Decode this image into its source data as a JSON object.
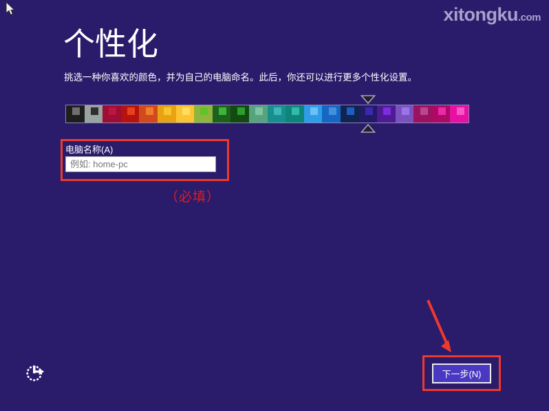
{
  "page": {
    "title": "个性化",
    "subtitle": "挑选一种你喜欢的颜色，并为自己的电脑命名。此后，你还可以进行更多个性化设置。"
  },
  "logo": {
    "name": "xitongku",
    "tld": ".com"
  },
  "color_picker": {
    "selected_index": 16,
    "swatches": [
      {
        "bg": "#1e1e1e",
        "accent": "#6f6f6f"
      },
      {
        "bg": "#9aa2a2",
        "accent": "#2e2e2e"
      },
      {
        "bg": "#9e0d33",
        "accent": "#c11342"
      },
      {
        "bg": "#b51210",
        "accent": "#e5421d"
      },
      {
        "bg": "#d2491c",
        "accent": "#ef7d2e"
      },
      {
        "bg": "#e8a312",
        "accent": "#fbc232"
      },
      {
        "bg": "#fdc431",
        "accent": "#ffdc64"
      },
      {
        "bg": "#8fb63c",
        "accent": "#62c22b"
      },
      {
        "bg": "#1d611d",
        "accent": "#3bb53b"
      },
      {
        "bg": "#124a12",
        "accent": "#2b9e2b"
      },
      {
        "bg": "#56a47d",
        "accent": "#81c4a4"
      },
      {
        "bg": "#178f8f",
        "accent": "#3cb8b8"
      },
      {
        "bg": "#0f8579",
        "accent": "#2fbcab"
      },
      {
        "bg": "#2e9de8",
        "accent": "#70c0f5"
      },
      {
        "bg": "#1667c4",
        "accent": "#4590dc"
      },
      {
        "bg": "#12234f",
        "accent": "#1d5fc4"
      },
      {
        "bg": "#231a66",
        "accent": "#3a29ad"
      },
      {
        "bg": "#4f1b94",
        "accent": "#7a2ede"
      },
      {
        "bg": "#7a52be",
        "accent": "#9d74e8"
      },
      {
        "bg": "#9c1160",
        "accent": "#b8488e"
      },
      {
        "bg": "#ab0b62",
        "accent": "#ef27ae"
      },
      {
        "bg": "#e810a2",
        "accent": "#f757c6"
      }
    ]
  },
  "form": {
    "computer_name_label": "电脑名称(A)",
    "computer_name_placeholder": "例如: home-pc",
    "computer_name_value": ""
  },
  "annotations": {
    "required_note": "（必填）",
    "highlight_color": "#ee3a2c"
  },
  "footer": {
    "next_button_label": "下一步(N)"
  },
  "colors": {
    "background": "#2b1b6b",
    "button_bg": "#4a38c2",
    "logo_text": "#a7a2cc",
    "required_text": "#e21d1d"
  },
  "icons": {
    "cursor": "cursor-arrow-icon",
    "accessibility": "ease-of-access-icon",
    "selection_down": "selection-marker-down-icon",
    "selection_up": "selection-marker-up-icon",
    "annotation": "annotation-arrow-icon"
  }
}
